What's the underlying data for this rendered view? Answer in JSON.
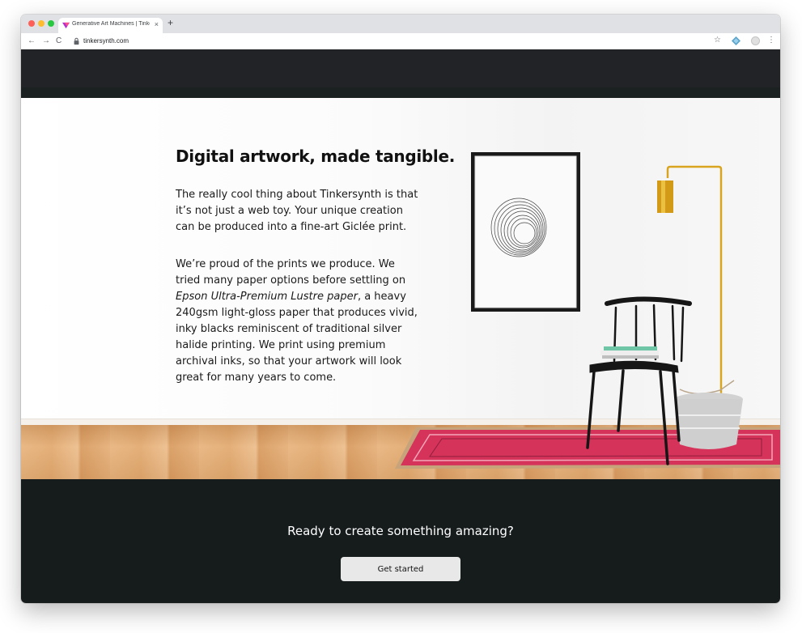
{
  "browser": {
    "tab_title": "Generative Art Machines | Tinkersynth",
    "tab_close": "×",
    "new_tab": "+",
    "back": "←",
    "forward": "→",
    "reload": "C",
    "url": "tinkersynth.com",
    "star": "☆",
    "menu": "⋮",
    "icons": [
      "tinkersynth-favicon",
      "lock-icon",
      "star-icon",
      "extension-icon",
      "profile-icon",
      "menu-icon"
    ]
  },
  "section": {
    "heading": "Digital artwork, made tangible.",
    "paragraph1": "The really cool thing about Tinkersynth is that it’s not just a web toy. Your unique creation can be produced into a fine-art Giclée print.",
    "paragraph2_before": "We’re proud of the prints we produce. We tried many paper options before settling on ",
    "paragraph2_emphasis": "Epson Ultra-Premium Lustre paper",
    "paragraph2_after": ", a heavy 240gsm light-gloss paper that produces vivid, inky blacks reminiscent of traditional silver halide printing. We print using premium archival inks, so that your artwork will look great for many years to come."
  },
  "cta": {
    "title": "Ready to create something amazing?",
    "button_label": "Get started"
  },
  "colors": {
    "top_band": "#222327",
    "cta_background": "#161b1c",
    "button_background": "#e8e8e8",
    "rug": "#d6335a",
    "lamp_gold": "#d9a520"
  }
}
